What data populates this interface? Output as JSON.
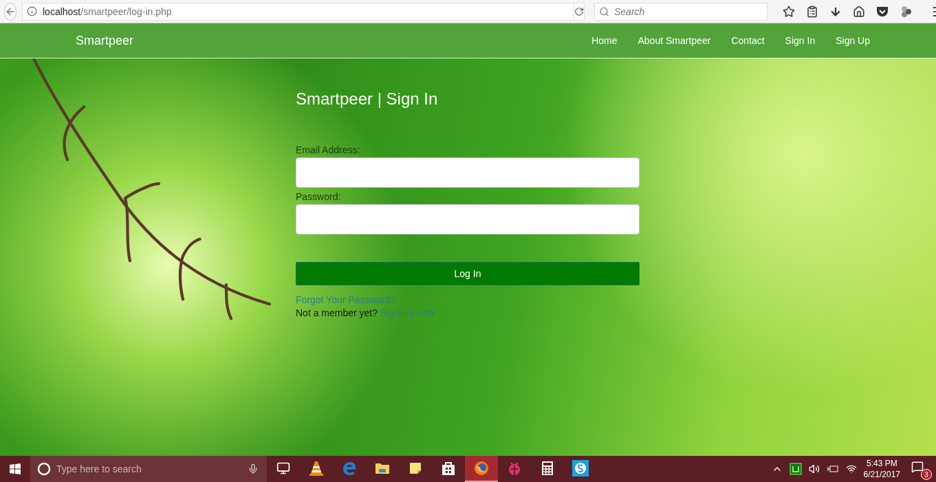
{
  "browser": {
    "url_host": "localhost",
    "url_path": "/smartpeer/log-in.php",
    "search_placeholder": "Search"
  },
  "navbar": {
    "brand": "Smartpeer",
    "links": [
      {
        "label": "Home"
      },
      {
        "label": "About Smartpeer"
      },
      {
        "label": "Contact"
      },
      {
        "label": "Sign In"
      },
      {
        "label": "Sign Up"
      }
    ]
  },
  "form": {
    "title": "Smartpeer | Sign In",
    "fields": [
      {
        "label": "Email Address:"
      },
      {
        "label": "Password:"
      }
    ],
    "submit": "Log In",
    "forgot_link": "Forgot Your Password?",
    "signup_prompt": "Not a member yet?",
    "signup_link": "Sign Up now"
  },
  "taskbar": {
    "search_placeholder": "Type here to search",
    "apps": [
      {
        "kind": "taskview",
        "selected": false
      },
      {
        "kind": "cone",
        "selected": false
      },
      {
        "kind": "edge",
        "selected": false
      },
      {
        "kind": "folder",
        "selected": false
      },
      {
        "kind": "note",
        "selected": false
      },
      {
        "kind": "store",
        "selected": false
      },
      {
        "kind": "firefox",
        "selected": true
      },
      {
        "kind": "bug",
        "selected": false
      },
      {
        "kind": "calculator",
        "selected": false
      },
      {
        "kind": "chat",
        "selected": false
      }
    ],
    "time": "5:43 PM",
    "date": "6/21/2017",
    "notifications": "3"
  }
}
